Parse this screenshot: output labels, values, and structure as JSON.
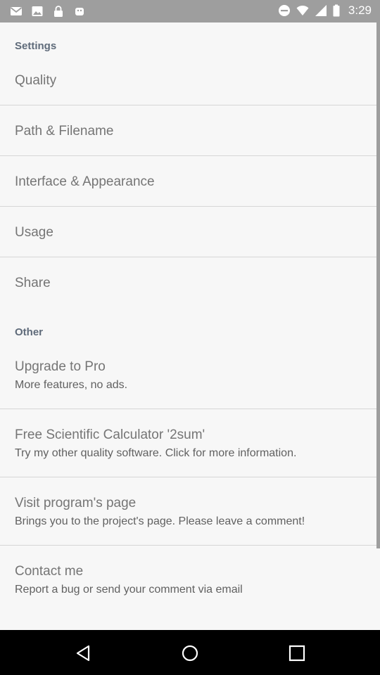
{
  "status_bar": {
    "time": "3:29",
    "left_icons": [
      "gmail-icon",
      "image-icon",
      "lock-icon",
      "android-icon"
    ],
    "right_icons": [
      "dnd-icon",
      "wifi-icon",
      "signal-icon",
      "battery-icon"
    ]
  },
  "settings": {
    "header": "Settings",
    "items": [
      {
        "title": "Quality"
      },
      {
        "title": "Path & Filename"
      },
      {
        "title": "Interface & Appearance"
      },
      {
        "title": "Usage"
      },
      {
        "title": "Share"
      }
    ]
  },
  "other": {
    "header": "Other",
    "items": [
      {
        "title": "Upgrade to Pro",
        "summary": "More features, no ads."
      },
      {
        "title": "Free Scientific Calculator '2sum'",
        "summary": "Try my other quality software. Click for more information."
      },
      {
        "title": "Visit program's page",
        "summary": "Brings you to the project's page. Please leave a comment!"
      },
      {
        "title": "Contact me",
        "summary": "Report a bug or send your comment via email"
      }
    ]
  },
  "nav_bar": {
    "buttons": [
      "back-icon",
      "home-icon",
      "recents-icon"
    ]
  }
}
